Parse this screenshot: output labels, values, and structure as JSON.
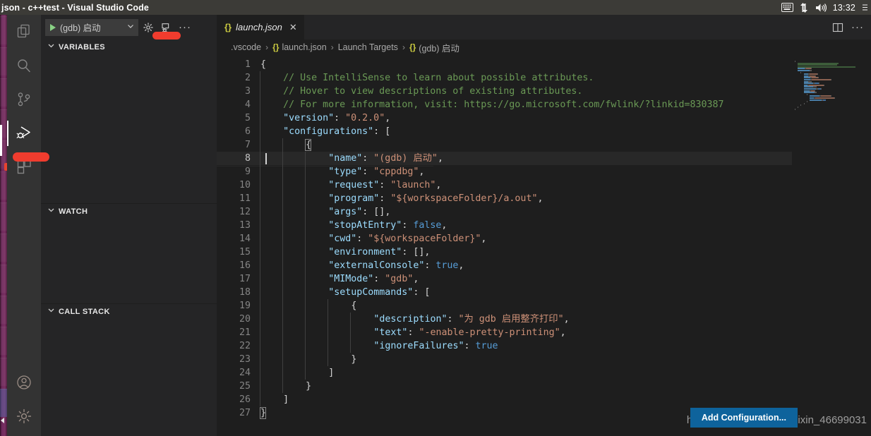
{
  "system_panel": {
    "window_title": "json - c++test - Visual Studio Code",
    "clock": "13:32",
    "icons": [
      "keyboard-icon",
      "network-icon",
      "volume-icon"
    ]
  },
  "activity_bar": {
    "items": [
      {
        "name": "explorer",
        "icon": "files-icon",
        "active": false
      },
      {
        "name": "search",
        "icon": "search-icon",
        "active": false
      },
      {
        "name": "source-control",
        "icon": "source-control-icon",
        "active": false
      },
      {
        "name": "run-and-debug",
        "icon": "run-debug-icon",
        "active": true
      },
      {
        "name": "extensions",
        "icon": "extensions-icon",
        "active": false
      }
    ],
    "bottom_items": [
      {
        "name": "accounts",
        "icon": "account-icon"
      },
      {
        "name": "manage",
        "icon": "gear-icon"
      }
    ]
  },
  "sidebar": {
    "debug_toolbar": {
      "configuration_label": "(gdb) 启动",
      "start_icon": "play-icon",
      "dropdown_icon": "chevron-down-icon",
      "gear_icon": "gear-icon",
      "console_icon": "debug-console-icon",
      "more_label": "···"
    },
    "panes": [
      {
        "title": "VARIABLES",
        "collapsed": false
      },
      {
        "title": "WATCH",
        "collapsed": false
      },
      {
        "title": "CALL STACK",
        "collapsed": false
      }
    ]
  },
  "editor": {
    "tab": {
      "icon": "json-braces-icon",
      "label": "launch.json",
      "close_label": "✕"
    },
    "actions": [
      {
        "name": "split-editor",
        "icon": "split-editor-icon"
      },
      {
        "name": "more-actions",
        "icon": "ellipsis-icon",
        "label": "···"
      }
    ],
    "breadcrumbs": [
      {
        "icon": "",
        "text": ".vscode"
      },
      {
        "icon": "{}",
        "text": "launch.json"
      },
      {
        "icon": "",
        "text": "Launch Targets"
      },
      {
        "icon": "{}",
        "text": "(gdb) 启动"
      }
    ],
    "breadcrumb_separator": "›",
    "active_line": 8,
    "lines": [
      {
        "n": 1,
        "indent": 0,
        "tokens": [
          {
            "c": "brk",
            "t": "{"
          }
        ]
      },
      {
        "n": 2,
        "indent": 1,
        "tokens": [
          {
            "c": "cmt",
            "t": "// Use IntelliSense to learn about possible attributes."
          }
        ]
      },
      {
        "n": 3,
        "indent": 1,
        "tokens": [
          {
            "c": "cmt",
            "t": "// Hover to view descriptions of existing attributes."
          }
        ]
      },
      {
        "n": 4,
        "indent": 1,
        "tokens": [
          {
            "c": "cmt",
            "t": "// For more information, visit: https://go.microsoft.com/fwlink/?linkid=830387"
          }
        ]
      },
      {
        "n": 5,
        "indent": 1,
        "tokens": [
          {
            "c": "key",
            "t": "\"version\""
          },
          {
            "c": "pct",
            "t": ": "
          },
          {
            "c": "str",
            "t": "\"0.2.0\""
          },
          {
            "c": "pct",
            "t": ","
          }
        ]
      },
      {
        "n": 6,
        "indent": 1,
        "tokens": [
          {
            "c": "key",
            "t": "\"configurations\""
          },
          {
            "c": "pct",
            "t": ": "
          },
          {
            "c": "brk",
            "t": "["
          }
        ]
      },
      {
        "n": 7,
        "indent": 2,
        "tokens": [
          {
            "c": "brk",
            "t": "{"
          }
        ]
      },
      {
        "n": 8,
        "indent": 3,
        "tokens": [
          {
            "c": "key",
            "t": "\"name\""
          },
          {
            "c": "pct",
            "t": ": "
          },
          {
            "c": "str",
            "t": "\"(gdb) 启动\""
          },
          {
            "c": "pct",
            "t": ","
          }
        ]
      },
      {
        "n": 9,
        "indent": 3,
        "tokens": [
          {
            "c": "key",
            "t": "\"type\""
          },
          {
            "c": "pct",
            "t": ": "
          },
          {
            "c": "str",
            "t": "\"cppdbg\""
          },
          {
            "c": "pct",
            "t": ","
          }
        ]
      },
      {
        "n": 10,
        "indent": 3,
        "tokens": [
          {
            "c": "key",
            "t": "\"request\""
          },
          {
            "c": "pct",
            "t": ": "
          },
          {
            "c": "str",
            "t": "\"launch\""
          },
          {
            "c": "pct",
            "t": ","
          }
        ]
      },
      {
        "n": 11,
        "indent": 3,
        "tokens": [
          {
            "c": "key",
            "t": "\"program\""
          },
          {
            "c": "pct",
            "t": ": "
          },
          {
            "c": "str",
            "t": "\"${workspaceFolder}/a.out\""
          },
          {
            "c": "pct",
            "t": ","
          }
        ]
      },
      {
        "n": 12,
        "indent": 3,
        "tokens": [
          {
            "c": "key",
            "t": "\"args\""
          },
          {
            "c": "pct",
            "t": ": "
          },
          {
            "c": "brk",
            "t": "[]"
          },
          {
            "c": "pct",
            "t": ","
          }
        ]
      },
      {
        "n": 13,
        "indent": 3,
        "tokens": [
          {
            "c": "key",
            "t": "\"stopAtEntry\""
          },
          {
            "c": "pct",
            "t": ": "
          },
          {
            "c": "bool",
            "t": "false"
          },
          {
            "c": "pct",
            "t": ","
          }
        ]
      },
      {
        "n": 14,
        "indent": 3,
        "tokens": [
          {
            "c": "key",
            "t": "\"cwd\""
          },
          {
            "c": "pct",
            "t": ": "
          },
          {
            "c": "str",
            "t": "\"${workspaceFolder}\""
          },
          {
            "c": "pct",
            "t": ","
          }
        ]
      },
      {
        "n": 15,
        "indent": 3,
        "tokens": [
          {
            "c": "key",
            "t": "\"environment\""
          },
          {
            "c": "pct",
            "t": ": "
          },
          {
            "c": "brk",
            "t": "[]"
          },
          {
            "c": "pct",
            "t": ","
          }
        ]
      },
      {
        "n": 16,
        "indent": 3,
        "tokens": [
          {
            "c": "key",
            "t": "\"externalConsole\""
          },
          {
            "c": "pct",
            "t": ": "
          },
          {
            "c": "bool",
            "t": "true"
          },
          {
            "c": "pct",
            "t": ","
          }
        ]
      },
      {
        "n": 17,
        "indent": 3,
        "tokens": [
          {
            "c": "key",
            "t": "\"MIMode\""
          },
          {
            "c": "pct",
            "t": ": "
          },
          {
            "c": "str",
            "t": "\"gdb\""
          },
          {
            "c": "pct",
            "t": ","
          }
        ]
      },
      {
        "n": 18,
        "indent": 3,
        "tokens": [
          {
            "c": "key",
            "t": "\"setupCommands\""
          },
          {
            "c": "pct",
            "t": ": "
          },
          {
            "c": "brk",
            "t": "["
          }
        ]
      },
      {
        "n": 19,
        "indent": 4,
        "tokens": [
          {
            "c": "brk",
            "t": "{"
          }
        ]
      },
      {
        "n": 20,
        "indent": 5,
        "tokens": [
          {
            "c": "key",
            "t": "\"description\""
          },
          {
            "c": "pct",
            "t": ": "
          },
          {
            "c": "str",
            "t": "\"为 gdb 启用整齐打印\""
          },
          {
            "c": "pct",
            "t": ","
          }
        ]
      },
      {
        "n": 21,
        "indent": 5,
        "tokens": [
          {
            "c": "key",
            "t": "\"text\""
          },
          {
            "c": "pct",
            "t": ": "
          },
          {
            "c": "str",
            "t": "\"-enable-pretty-printing\""
          },
          {
            "c": "pct",
            "t": ","
          }
        ]
      },
      {
        "n": 22,
        "indent": 5,
        "tokens": [
          {
            "c": "key",
            "t": "\"ignoreFailures\""
          },
          {
            "c": "pct",
            "t": ": "
          },
          {
            "c": "bool",
            "t": "true"
          }
        ]
      },
      {
        "n": 23,
        "indent": 4,
        "tokens": [
          {
            "c": "brk",
            "t": "}"
          }
        ]
      },
      {
        "n": 24,
        "indent": 3,
        "tokens": [
          {
            "c": "brk",
            "t": "]"
          }
        ]
      },
      {
        "n": 25,
        "indent": 2,
        "tokens": [
          {
            "c": "brk",
            "t": "}"
          }
        ]
      },
      {
        "n": 26,
        "indent": 1,
        "tokens": [
          {
            "c": "brk",
            "t": "]"
          }
        ]
      },
      {
        "n": 27,
        "indent": 0,
        "tokens": [
          {
            "c": "brk",
            "t": "}"
          }
        ]
      }
    ]
  },
  "overlays": {
    "add_configuration_label": "Add Configuration...",
    "watermark": "https://blog.csdn.net/weixin_46699031"
  },
  "colors": {
    "accent_blue": "#0e639c",
    "annotation_red": "#f03c2e",
    "editor_bg": "#1e1e1e",
    "sidebar_bg": "#252526",
    "activity_bg": "#333333",
    "comment_green": "#6a9955",
    "key_blue": "#9cdcfe",
    "string_orange": "#ce9178",
    "bool_blue": "#569cd6"
  }
}
